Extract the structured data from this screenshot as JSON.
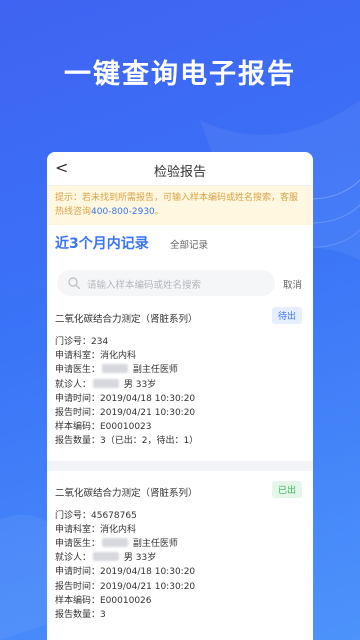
{
  "hero": {
    "title": "一键查询电子报告"
  },
  "nav": {
    "back": "<",
    "title": "检验报告"
  },
  "notice": {
    "text": "提示：若未找到所需报告，可输入样本编码或姓名搜索，客服热线咨询",
    "phone": "400-800-2930",
    "end": "。"
  },
  "records": {
    "title": "近3个月内记录",
    "all_label": "全部记录"
  },
  "search": {
    "placeholder": "请输入样本编码或姓名搜索",
    "cancel": "取消"
  },
  "cards": [
    {
      "title": "二氧化碳结合力测定（肾脏系列）",
      "status": "待出",
      "clinic_no": "门诊号：234",
      "dept": "申请科室：消化内科",
      "doctor_label": "申请医生：",
      "doctor_title": "副主任医师",
      "patient_label": "就诊人：",
      "patient_info": "男  33岁",
      "apply_time": "申请时间：2019/04/18  10:30:20",
      "report_time": "报告时间：2019/04/21  10:30:20",
      "sample_code": "样本编码：E00010023",
      "report_count": "报告数量：3（已出：2，待出：1）"
    },
    {
      "title": "二氧化碳结合力测定（肾脏系列）",
      "status": "已出",
      "clinic_no": "门诊号：45678765",
      "dept": "申请科室：消化内科",
      "doctor_label": "申请医生：",
      "doctor_title": "副主任医师",
      "patient_label": "就诊人：",
      "patient_info": "男  33岁",
      "apply_time": "申请时间：2019/04/18  10:30:20",
      "report_time": "报告时间：2019/04/21  10:30:20",
      "sample_code": "样本编码：E00010026",
      "report_count": "报告数量：3"
    }
  ],
  "colors": {
    "primary": "#3a74f7",
    "pending": "#3a74f7",
    "done": "#3bb357",
    "notice_text": "#d9a54a"
  },
  "icons": {
    "search": "search-icon",
    "back": "chevron-left-icon"
  }
}
